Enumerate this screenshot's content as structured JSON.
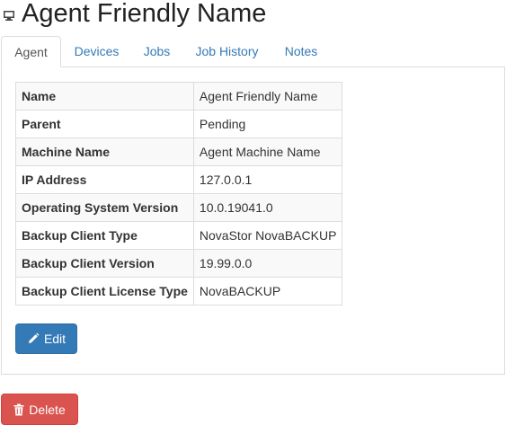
{
  "header": {
    "title": "Agent Friendly Name",
    "icon": "computer-icon"
  },
  "tabs": [
    {
      "label": "Agent",
      "active": true
    },
    {
      "label": "Devices",
      "active": false
    },
    {
      "label": "Jobs",
      "active": false
    },
    {
      "label": "Job History",
      "active": false
    },
    {
      "label": "Notes",
      "active": false
    }
  ],
  "details": [
    {
      "key": "Name",
      "value": "Agent Friendly Name"
    },
    {
      "key": "Parent",
      "value": "Pending"
    },
    {
      "key": "Machine Name",
      "value": "Agent Machine Name"
    },
    {
      "key": "IP Address",
      "value": "127.0.0.1"
    },
    {
      "key": "Operating System Version",
      "value": "10.0.19041.0"
    },
    {
      "key": "Backup Client Type",
      "value": "NovaStor NovaBACKUP"
    },
    {
      "key": "Backup Client Version",
      "value": "19.99.0.0"
    },
    {
      "key": "Backup Client License Type",
      "value": "NovaBACKUP"
    }
  ],
  "actions": {
    "edit_label": "Edit",
    "edit_icon": "pencil-icon",
    "delete_label": "Delete",
    "delete_icon": "trash-icon"
  },
  "colors": {
    "primary": "#337ab7",
    "danger": "#d9534f",
    "link": "#337ab7"
  }
}
